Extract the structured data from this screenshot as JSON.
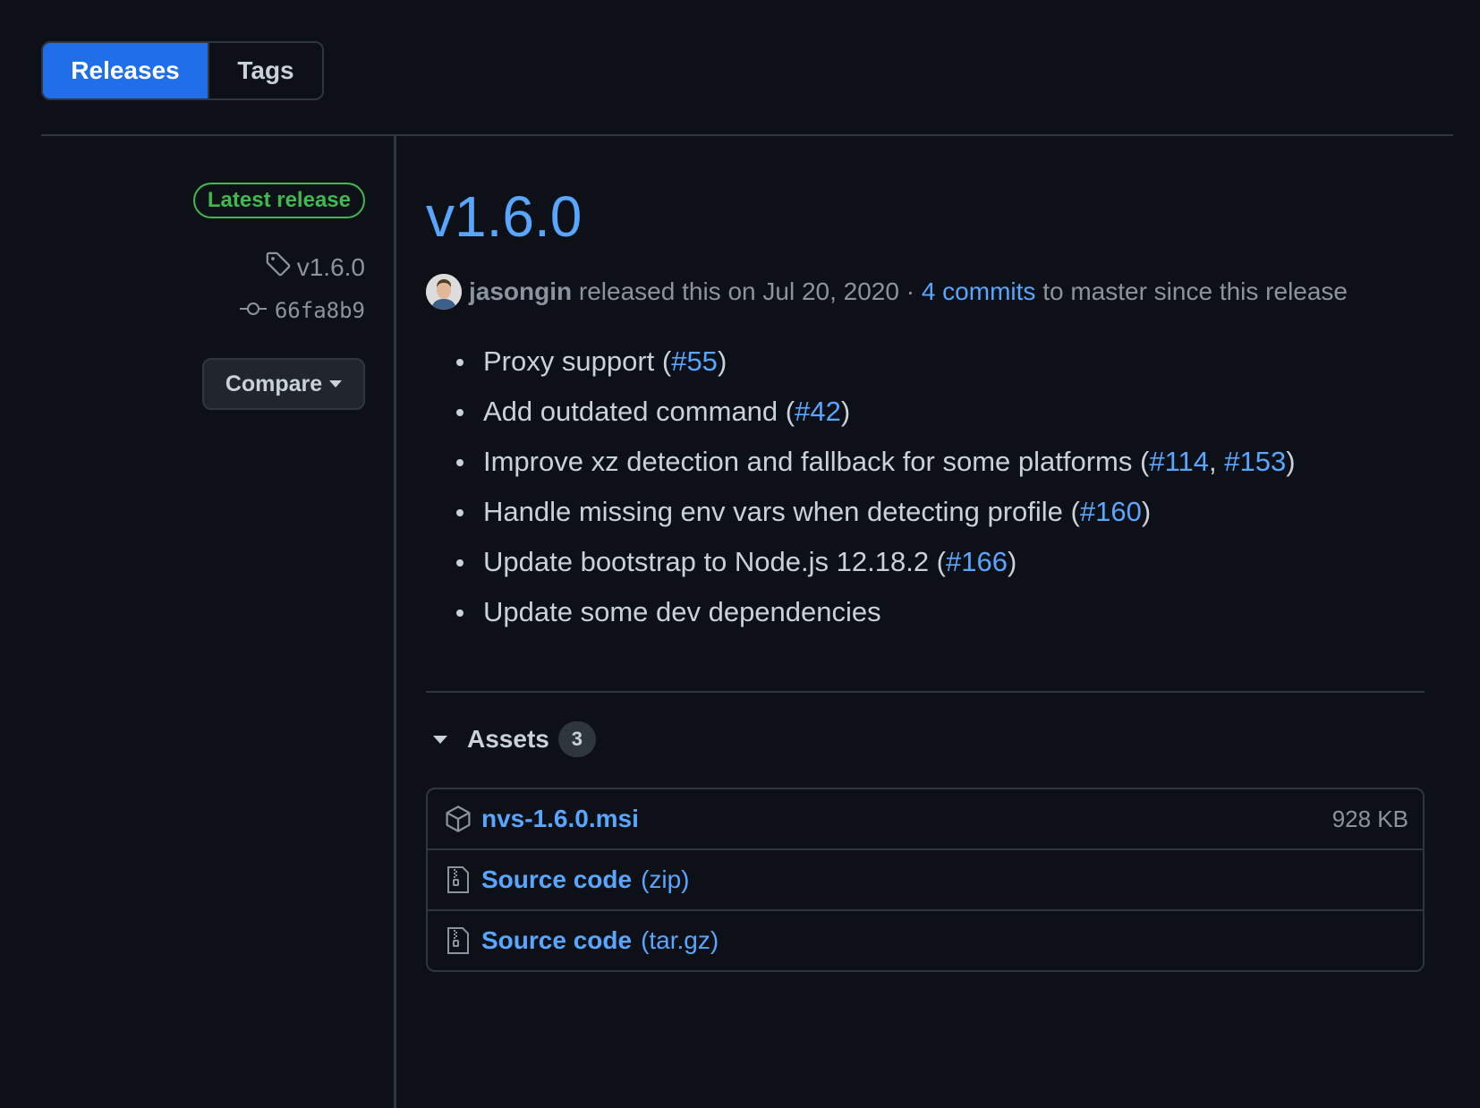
{
  "tabs": {
    "releases": "Releases",
    "tags": "Tags"
  },
  "meta": {
    "latest_badge": "Latest release",
    "tag": "v1.6.0",
    "commit": "66fa8b9",
    "compare_label": "Compare"
  },
  "release": {
    "version": "v1.6.0",
    "author": "jasongin",
    "released_text": "released this on Jul 20, 2020",
    "separator": "·",
    "commits_link": "4 commits",
    "commits_suffix": "to master since this release",
    "notes": [
      {
        "text": "Proxy support (",
        "links": [
          "#55"
        ],
        "close": ")"
      },
      {
        "text": "Add outdated command (",
        "links": [
          "#42"
        ],
        "close": ")"
      },
      {
        "text": "Improve xz detection and fallback for some platforms (",
        "links": [
          "#114",
          "#153"
        ],
        "link_sep": ", ",
        "close": ")"
      },
      {
        "text": "Handle missing env vars when detecting profile (",
        "links": [
          "#160"
        ],
        "close": ")"
      },
      {
        "text": "Update bootstrap to Node.js 12.18.2 (",
        "links": [
          "#166"
        ],
        "close": ")"
      },
      {
        "text": "Update some dev dependencies"
      }
    ]
  },
  "assets": {
    "label": "Assets",
    "count": "3",
    "items": [
      {
        "icon": "package-icon",
        "name": "nvs-1.6.0.msi",
        "ext": "",
        "size": "928 KB"
      },
      {
        "icon": "file-zip-icon",
        "name": "Source code",
        "ext": "(zip)",
        "size": ""
      },
      {
        "icon": "file-zip-icon",
        "name": "Source code",
        "ext": "(tar.gz)",
        "size": ""
      }
    ]
  },
  "colors": {
    "background": "#0d1117",
    "accent": "#58a6ff",
    "selected_tab": "#1f6feb",
    "latest_green": "#3fb950",
    "border": "#30363d"
  }
}
